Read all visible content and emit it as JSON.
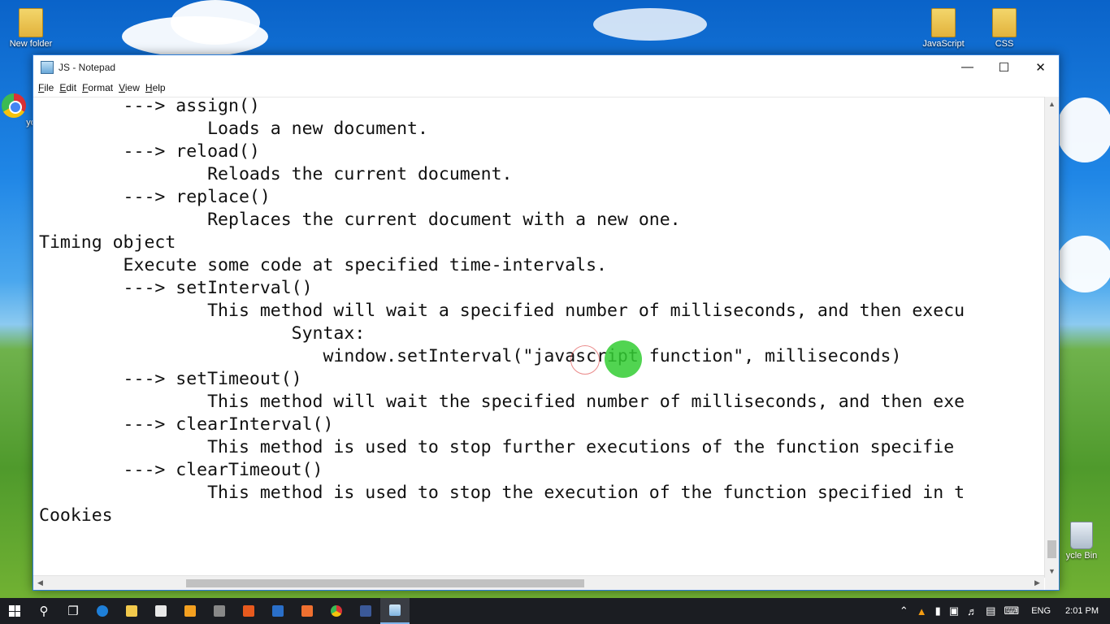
{
  "desktop": {
    "icons": [
      {
        "label": "New folder"
      },
      {
        "label": "JavaScript"
      },
      {
        "label": "CSS"
      },
      {
        "label": "yo"
      },
      {
        "label": "ycle Bin"
      }
    ]
  },
  "window": {
    "title": "JS - Notepad",
    "controls": {
      "minimize": "—",
      "maximize": "☐",
      "close": "✕"
    },
    "menu": [
      {
        "first": "F",
        "rest": "ile"
      },
      {
        "first": "E",
        "rest": "dit"
      },
      {
        "first": "F",
        "rest": "ormat"
      },
      {
        "first": "V",
        "rest": "iew"
      },
      {
        "first": "H",
        "rest": "elp"
      }
    ],
    "editor_text": "        ---> assign()\n                Loads a new document.\n        ---> reload()\n                Reloads the current document.\n        ---> replace()\n                Replaces the current document with a new one.\nTiming object\n        Execute some code at specified time-intervals.\n        ---> setInterval()\n                This method will wait a specified number of milliseconds, and then execu\n                        Syntax:\n                           window.setInterval(\"javascript function\", milliseconds)\n        ---> setTimeout()\n                This method will wait the specified number of milliseconds, and then exe\n        ---> clearInterval()\n                This method is used to stop further executions of the function specifie\n        ---> clearTimeout()\n                This method is used to stop the execution of the function specified in t\nCookies",
    "scroll_arrows": {
      "up": "▲",
      "down": "▼",
      "left": "◀",
      "right": "▶"
    }
  },
  "taskbar": {
    "language": "ENG",
    "time": "2:01 PM",
    "colors": {
      "background": "#1b1d22",
      "accent": "#7fb3ea"
    }
  }
}
